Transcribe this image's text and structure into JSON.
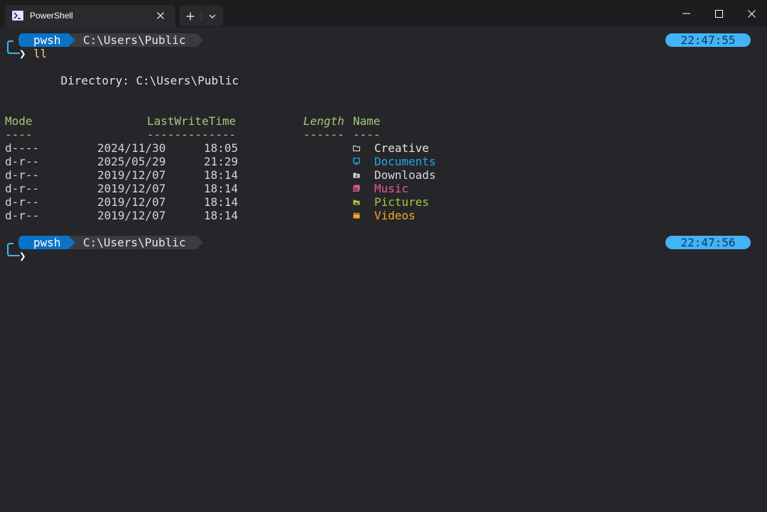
{
  "window": {
    "tab_title": "PowerShell",
    "icons": [
      "powershell-icon",
      "close-icon",
      "plus-icon",
      "chevron-down-icon",
      "minimize-icon",
      "maximize-icon",
      "close-window-icon"
    ]
  },
  "prompt1": {
    "shell": "pwsh",
    "path": "C:\\Users\\Public",
    "time": "22:47:55",
    "chevron": "❯",
    "command": "ll"
  },
  "output": {
    "directory_line": "    Directory: C:\\Users\\Public",
    "headers": {
      "mode": "Mode",
      "lastwritetime": "LastWriteTime",
      "length": "Length",
      "name": "Name"
    },
    "underlines": {
      "mode": "----",
      "lastwritetime": "-------------",
      "length": "------",
      "name": "----"
    },
    "rows": [
      {
        "mode": "d----",
        "date": "2024/11/30",
        "time": "18:05",
        "name": "Creative",
        "icon": "folder-icon",
        "color": "#e4e4e4"
      },
      {
        "mode": "d-r--",
        "date": "2025/05/29",
        "time": "21:29",
        "name": "Documents",
        "icon": "documents-icon",
        "color": "#1fa8e8"
      },
      {
        "mode": "d-r--",
        "date": "2019/12/07",
        "time": "18:14",
        "name": "Downloads",
        "icon": "downloads-icon",
        "color": "#d8d8d8"
      },
      {
        "mode": "d-r--",
        "date": "2019/12/07",
        "time": "18:14",
        "name": "Music",
        "icon": "music-icon",
        "color": "#e05a9a"
      },
      {
        "mode": "d-r--",
        "date": "2019/12/07",
        "time": "18:14",
        "name": "Pictures",
        "icon": "pictures-icon",
        "color": "#9ecb3d"
      },
      {
        "mode": "d-r--",
        "date": "2019/12/07",
        "time": "18:14",
        "name": "Videos",
        "icon": "videos-icon",
        "color": "#f5a623"
      }
    ]
  },
  "prompt2": {
    "shell": "pwsh",
    "path": "C:\\Users\\Public",
    "time": "22:47:56",
    "chevron": "❯"
  },
  "colors": {
    "background": "#26262a",
    "titlebar": "#1d1d1f",
    "header_green": "#a3c97a",
    "accent_blue": "#0a73c7",
    "clock_blue": "#42b4f5",
    "command_yellow": "#e8d27a"
  }
}
